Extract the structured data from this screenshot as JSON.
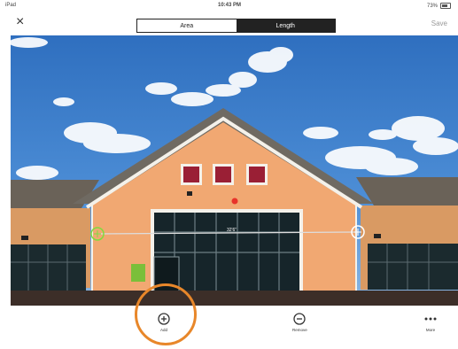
{
  "status_bar": {
    "device": "iPad",
    "time": "10:43 PM",
    "battery": "73%"
  },
  "nav": {
    "close_icon": "×",
    "tabs": [
      {
        "label": "Area",
        "selected": false
      },
      {
        "label": "Length",
        "selected": true
      }
    ],
    "save_label": "Save"
  },
  "photo": {
    "measurement_label": "32'6\""
  },
  "toolbar": {
    "items": [
      {
        "label": "Add",
        "icon": "plus-circle-icon"
      },
      {
        "label": "Remove",
        "icon": "minus-circle-icon"
      },
      {
        "label": "More",
        "icon": "more-dots-icon"
      }
    ]
  },
  "colors": {
    "highlight": "#E8872A",
    "active_segment": "#222222",
    "sky": "#3f7fc8",
    "wall": "#f0a56e"
  }
}
